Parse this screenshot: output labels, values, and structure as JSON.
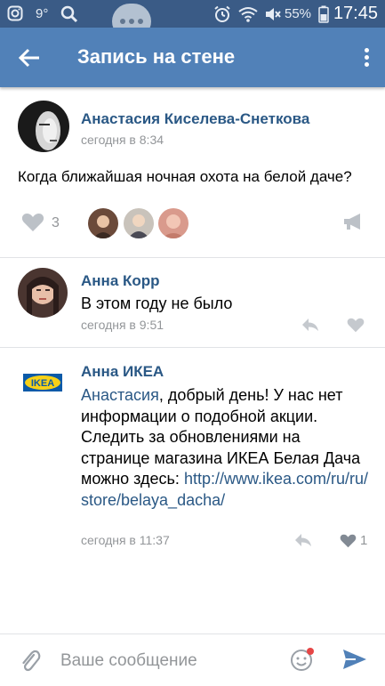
{
  "status_bar": {
    "temperature": "9°",
    "battery": "55%",
    "time": "17:45",
    "icons": [
      "instagram-icon",
      "search-icon",
      "alarm-icon",
      "wifi-icon",
      "mute-icon",
      "signal-icon",
      "battery-icon"
    ]
  },
  "toolbar": {
    "title": "Запись на стене",
    "back_icon": "arrow-left-icon",
    "more_icon": "more-vertical-icon"
  },
  "post": {
    "author": "Анастасия Киселева-Снеткова",
    "time": "сегодня в 8:34",
    "text": "Когда ближайшая ночная охота на белой даче?",
    "likes_count": "3",
    "liker_avatars": 3,
    "share_icon": "megaphone-icon"
  },
  "comments": [
    {
      "author": "Анна Корр",
      "text": "В этом году не было",
      "time": "сегодня в 9:51",
      "likes": ""
    },
    {
      "author": "Анна ИКЕА",
      "logo_text": "IKEA",
      "mention": "Анастасия",
      "text_after_mention": ", добрый день! У нас нет информации о подобной акции. Следить за обновлениями на странице магазина ИКЕА Белая Дача можно здесь: ",
      "link": "http://www.ikea.com/ru/ru/store/belaya_dacha/",
      "time": "сегодня в 11:37",
      "likes": "1"
    }
  ],
  "composer": {
    "placeholder": "Ваше сообщение",
    "attach_icon": "paperclip-icon",
    "emoji_icon": "smiley-icon",
    "send_icon": "send-icon"
  },
  "colors": {
    "status_bar": "#3a5b86",
    "toolbar": "#5181b8",
    "link": "#2a5885",
    "meta": "#939699"
  }
}
